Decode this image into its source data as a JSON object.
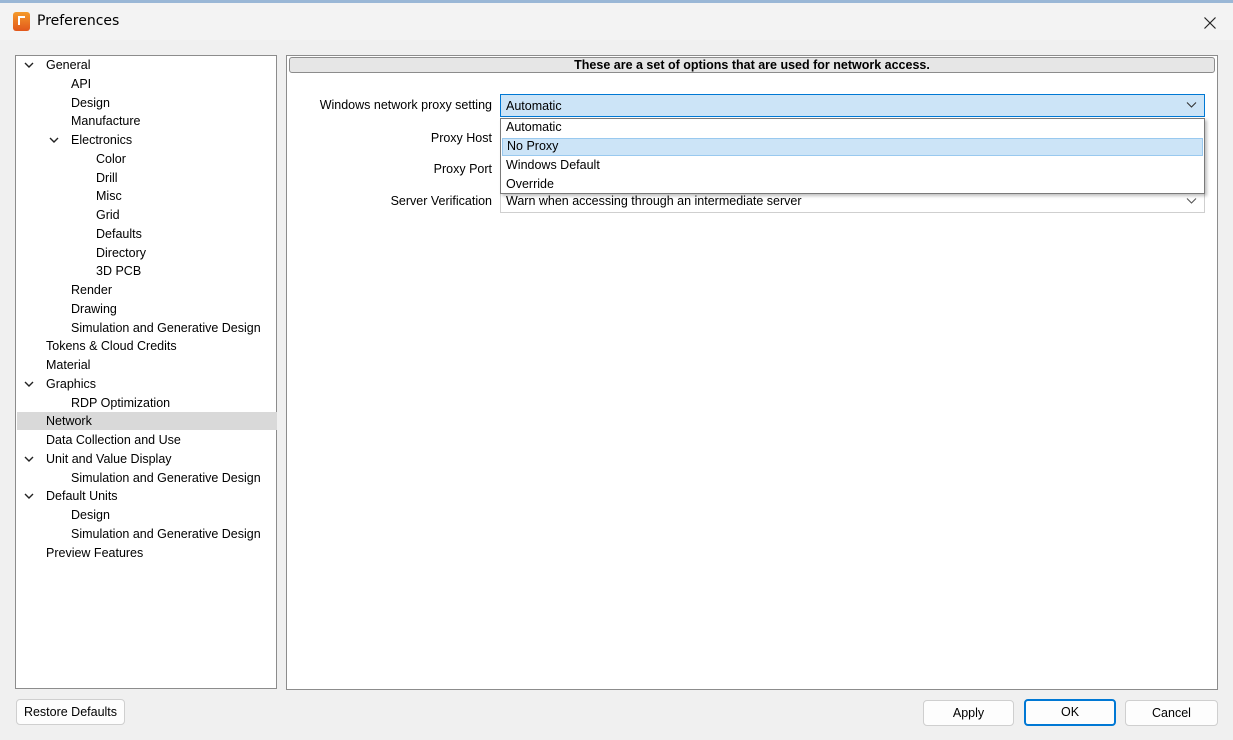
{
  "window": {
    "title": "Preferences"
  },
  "colors": {
    "accent": "#0078d4",
    "selection_bg": "#cce4f7",
    "tree_selected": "#d9d9d9"
  },
  "tree": [
    {
      "label": "General",
      "level": 0,
      "expanded": true
    },
    {
      "label": "API",
      "level": 1
    },
    {
      "label": "Design",
      "level": 1
    },
    {
      "label": "Manufacture",
      "level": 1
    },
    {
      "label": "Electronics",
      "level": 1,
      "expanded": true
    },
    {
      "label": "Color",
      "level": 2
    },
    {
      "label": "Drill",
      "level": 2
    },
    {
      "label": "Misc",
      "level": 2
    },
    {
      "label": "Grid",
      "level": 2
    },
    {
      "label": "Defaults",
      "level": 2
    },
    {
      "label": "Directory",
      "level": 2
    },
    {
      "label": "3D PCB",
      "level": 2
    },
    {
      "label": "Render",
      "level": 1
    },
    {
      "label": "Drawing",
      "level": 1
    },
    {
      "label": "Simulation and Generative Design",
      "level": 1
    },
    {
      "label": "Tokens & Cloud Credits",
      "level": 0
    },
    {
      "label": "Material",
      "level": 0
    },
    {
      "label": "Graphics",
      "level": 0,
      "expanded": true
    },
    {
      "label": "RDP Optimization",
      "level": 1
    },
    {
      "label": "Network",
      "level": 0,
      "selected": true
    },
    {
      "label": "Data Collection and Use",
      "level": 0
    },
    {
      "label": "Unit and Value Display",
      "level": 0,
      "expanded": true
    },
    {
      "label": "Simulation and Generative Design",
      "level": 1
    },
    {
      "label": "Default Units",
      "level": 0,
      "expanded": true
    },
    {
      "label": "Design",
      "level": 1
    },
    {
      "label": "Simulation and Generative Design",
      "level": 1
    },
    {
      "label": "Preview Features",
      "level": 0
    }
  ],
  "panel": {
    "header": "These are a set of options that are used for network access.",
    "proxy_setting": {
      "label": "Windows network proxy setting",
      "value": "Automatic",
      "options": [
        "Automatic",
        "No Proxy",
        "Windows Default",
        "Override"
      ],
      "highlighted": "No Proxy"
    },
    "proxy_host": {
      "label": "Proxy Host"
    },
    "proxy_port": {
      "label": "Proxy Port"
    },
    "server_verification": {
      "label": "Server Verification",
      "value": "Warn when accessing through an intermediate server"
    }
  },
  "buttons": {
    "restore_defaults": "Restore Defaults",
    "apply": "Apply",
    "ok": "OK",
    "cancel": "Cancel"
  }
}
